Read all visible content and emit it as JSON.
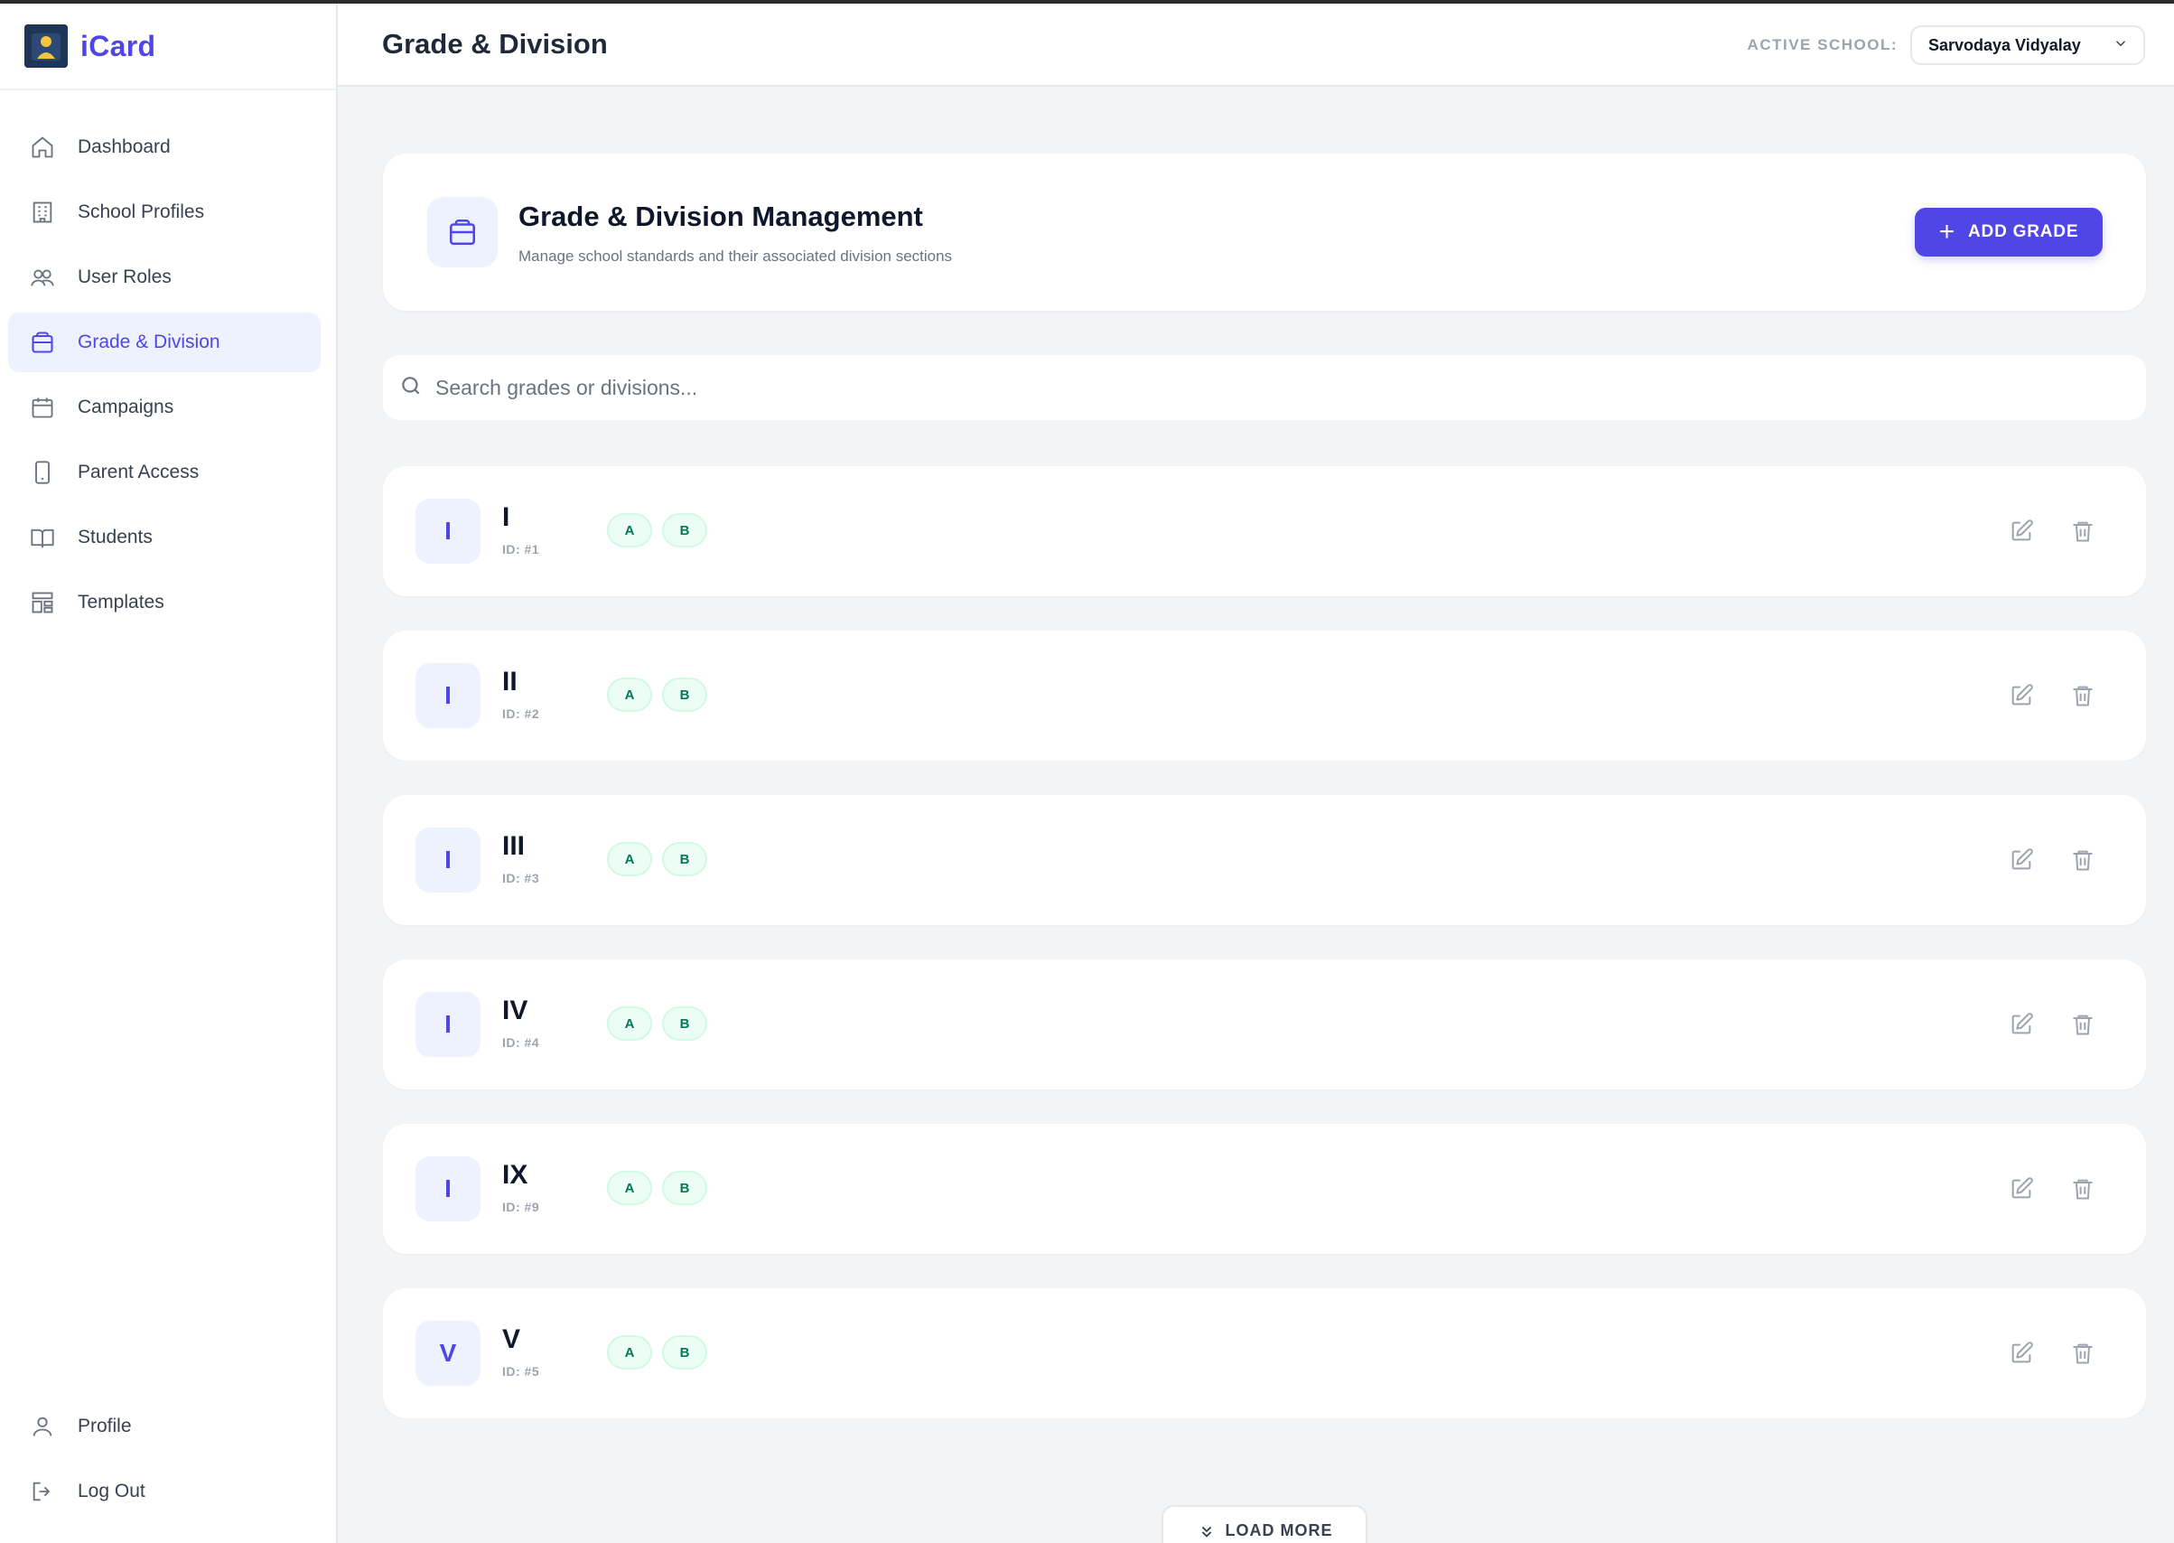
{
  "brand": {
    "name": "iCard"
  },
  "sidebar": {
    "items": [
      {
        "label": "Dashboard",
        "icon": "home-icon"
      },
      {
        "label": "School Profiles",
        "icon": "building-icon"
      },
      {
        "label": "User Roles",
        "icon": "users-icon"
      },
      {
        "label": "Grade & Division",
        "icon": "layers-icon",
        "active": true
      },
      {
        "label": "Campaigns",
        "icon": "calendar-icon"
      },
      {
        "label": "Parent Access",
        "icon": "phone-icon"
      },
      {
        "label": "Students",
        "icon": "book-icon"
      },
      {
        "label": "Templates",
        "icon": "layout-icon"
      }
    ],
    "bottom": [
      {
        "label": "Profile",
        "icon": "user-icon"
      },
      {
        "label": "Log Out",
        "icon": "logout-icon"
      }
    ]
  },
  "header": {
    "title": "Grade & Division",
    "active_school_label": "ACTIVE SCHOOL:",
    "active_school_value": "Sarvodaya Vidyalay"
  },
  "management": {
    "title": "Grade & Division Management",
    "subtitle": "Manage school standards and their associated division sections",
    "add_label": "ADD GRADE"
  },
  "search": {
    "placeholder": "Search grades or divisions..."
  },
  "grades": [
    {
      "badge": "I",
      "name": "I",
      "id": "ID: #1",
      "divisions": [
        "A",
        "B"
      ]
    },
    {
      "badge": "I",
      "name": "II",
      "id": "ID: #2",
      "divisions": [
        "A",
        "B"
      ]
    },
    {
      "badge": "I",
      "name": "III",
      "id": "ID: #3",
      "divisions": [
        "A",
        "B"
      ]
    },
    {
      "badge": "I",
      "name": "IV",
      "id": "ID: #4",
      "divisions": [
        "A",
        "B"
      ]
    },
    {
      "badge": "I",
      "name": "IX",
      "id": "ID: #9",
      "divisions": [
        "A",
        "B"
      ]
    },
    {
      "badge": "V",
      "name": "V",
      "id": "ID: #5",
      "divisions": [
        "A",
        "B"
      ]
    }
  ],
  "load_more": {
    "label": "LOAD MORE"
  },
  "colors": {
    "accent": "#4f46e5",
    "chip_text": "#047857",
    "chip_bg": "#ecfdf5"
  }
}
